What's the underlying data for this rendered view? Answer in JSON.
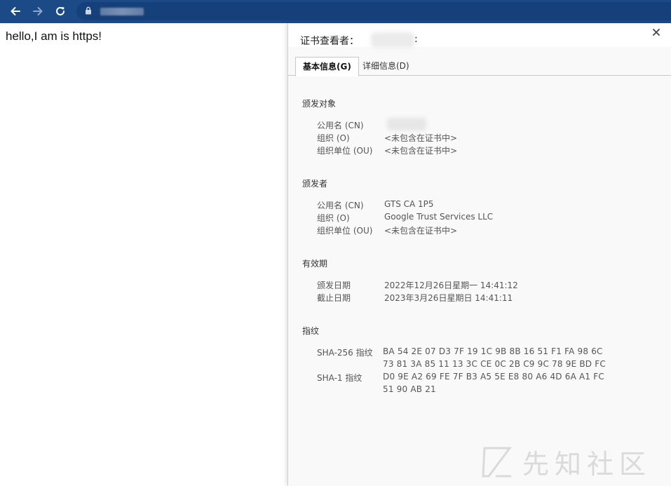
{
  "browser": {
    "back_icon": "arrow-left-icon",
    "forward_icon": "arrow-right-icon",
    "reload_icon": "reload-icon",
    "lock_icon": "lock-icon",
    "toolbar_color": "#1b4a86"
  },
  "page": {
    "body_text": "hello,I am is https!"
  },
  "cert_viewer": {
    "title_prefix": "证书查看者：",
    "title_suffix": ":",
    "close_label": "×",
    "tabs": [
      {
        "label": "基本信息(G)",
        "active": true
      },
      {
        "label": "详细信息(D)",
        "active": false
      }
    ],
    "issued_to": {
      "heading": "颁发对象",
      "rows": [
        {
          "label": "公用名 (CN)",
          "value": ""
        },
        {
          "label": "组织 (O)",
          "value": "<未包含在证书中>"
        },
        {
          "label": "组织单位 (OU)",
          "value": "<未包含在证书中>"
        }
      ]
    },
    "issued_by": {
      "heading": "颁发者",
      "rows": [
        {
          "label": "公用名 (CN)",
          "value": "GTS CA 1P5"
        },
        {
          "label": "组织 (O)",
          "value": "Google Trust Services LLC"
        },
        {
          "label": "组织单位 (OU)",
          "value": "<未包含在证书中>"
        }
      ]
    },
    "validity": {
      "heading": "有效期",
      "rows": [
        {
          "label": "颁发日期",
          "value": "2022年12月26日星期一 14:41:12"
        },
        {
          "label": "截止日期",
          "value": "2023年3月26日星期日 14:41:11"
        }
      ]
    },
    "fingerprints": {
      "heading": "指纹",
      "sha256_label": "SHA-256 指纹",
      "sha256_line1": "BA 54 2E 07 D3 7F 19 1C 9B 8B 16 51 F1 FA 98 6C",
      "sha256_line2": "73 81 3A 85 11 13 3C CE 0C 2B C9 9C 78 9E BD FC",
      "sha1_label": "SHA-1 指纹",
      "sha1_line1": "D0 9E A2 69 FE 7F B3 A5 5E E8 80 A6 4D 6A A1 FC",
      "sha1_line2": "51 90 AB 21"
    }
  },
  "watermark": {
    "text": "先知社区",
    "logo": "xianzhi-logo-icon"
  }
}
